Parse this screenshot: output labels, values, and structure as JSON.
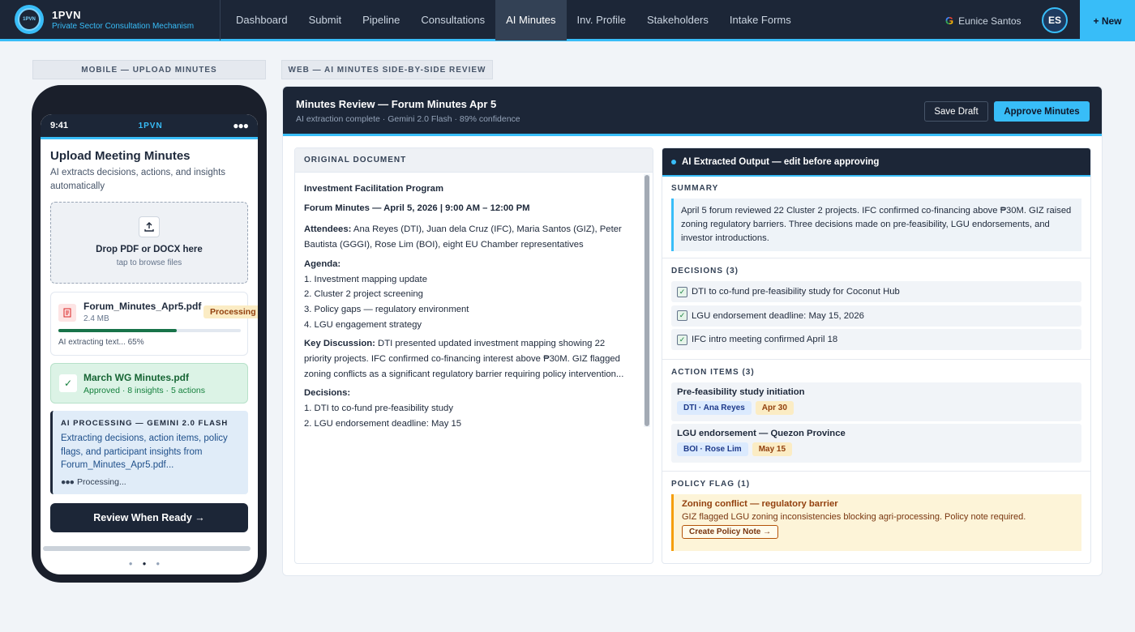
{
  "nav": {
    "brand_name": "1PVN",
    "brand_sub": "Private Sector Consultation Mechanism",
    "logo_text": "1PVN",
    "links": [
      "Dashboard",
      "Submit",
      "Pipeline",
      "Consultations",
      "AI Minutes",
      "Inv. Profile",
      "Stakeholders",
      "Intake Forms"
    ],
    "active_link": "AI Minutes",
    "user_name": "Eunice Santos",
    "user_initials": "ES",
    "new_button": "+ New"
  },
  "labels": {
    "mobile": "MOBILE — UPLOAD MINUTES",
    "web": "WEB — AI MINUTES SIDE-BY-SIDE REVIEW"
  },
  "mobile": {
    "time": "9:41",
    "app": "1PVN",
    "title": "Upload Meeting Minutes",
    "subtitle": "AI extracts decisions, actions, and insights automatically",
    "drop_title": "Drop PDF or DOCX here",
    "drop_sub": "tap to browse files",
    "file": {
      "name": "Forum_Minutes_Apr5.pdf",
      "size": "2.4 MB",
      "status": "Processing",
      "progress": 0.65,
      "progress_text": "AI extracting text... 65%"
    },
    "done": {
      "name": "March WG Minutes.pdf",
      "meta": "Approved · 8 insights · 5 actions"
    },
    "ai": {
      "head": "AI PROCESSING — GEMINI 2.0 FLASH",
      "body": "Extracting decisions, action items, policy flags, and participant insights from Forum_Minutes_Apr5.pdf...",
      "processing": "Processing..."
    },
    "review_button": "Review When Ready →"
  },
  "web": {
    "title": "Minutes Review — Forum Minutes Apr 5",
    "subtitle": "AI extraction complete · Gemini 2.0 Flash · 89% confidence",
    "save_draft": "Save Draft",
    "approve": "Approve Minutes",
    "original": {
      "header": "ORIGINAL DOCUMENT",
      "program": "Investment Facilitation Program",
      "forum": "Forum Minutes — April 5, 2026 | 9:00 AM – 12:00 PM",
      "attendees_label": "Attendees:",
      "attendees": "Ana Reyes (DTI), Juan dela Cruz (IFC), Maria Santos (GIZ), Peter Bautista (GGGI), Rose Lim (BOI), eight EU Chamber representatives",
      "agenda_label": "Agenda:",
      "agenda": [
        "1. Investment mapping update",
        "2. Cluster 2 project screening",
        "3. Policy gaps — regulatory environment",
        "4. LGU engagement strategy"
      ],
      "discussion_label": "Key Discussion:",
      "discussion": "DTI presented updated investment mapping showing 22 priority projects. IFC confirmed co-financing interest above ₱30M. GIZ flagged zoning conflicts as a significant regulatory barrier requiring policy intervention...",
      "decisions_label": "Decisions:",
      "decisions": [
        "1. DTI to co-fund pre-feasibility study",
        "2. LGU endorsement deadline: May 15"
      ]
    },
    "ai_output": {
      "header": "AI Extracted Output — edit before approving",
      "summary_label": "SUMMARY",
      "summary": "April 5 forum reviewed 22 Cluster 2 projects. IFC confirmed co-financing above ₱30M. GIZ raised zoning regulatory barriers. Three decisions made on pre-feasibility, LGU endorsements, and investor introductions.",
      "decisions_label": "DECISIONS (3)",
      "decisions": [
        "DTI to co-fund pre-feasibility study for Coconut Hub",
        "LGU endorsement deadline: May 15, 2026",
        "IFC intro meeting confirmed April 18"
      ],
      "actions_label": "ACTION ITEMS (3)",
      "actions": [
        {
          "title": "Pre-feasibility study initiation",
          "owner": "DTI · Ana Reyes",
          "due": "Apr 30"
        },
        {
          "title": "LGU endorsement — Quezon Province",
          "owner": "BOI · Rose Lim",
          "due": "May 15"
        }
      ],
      "flag_label": "POLICY FLAG (1)",
      "flag": {
        "title": "Zoning conflict — regulatory barrier",
        "body": "GIZ flagged LGU zoning inconsistencies blocking agri-processing. Policy note required.",
        "button": "Create Policy Note →"
      }
    }
  }
}
